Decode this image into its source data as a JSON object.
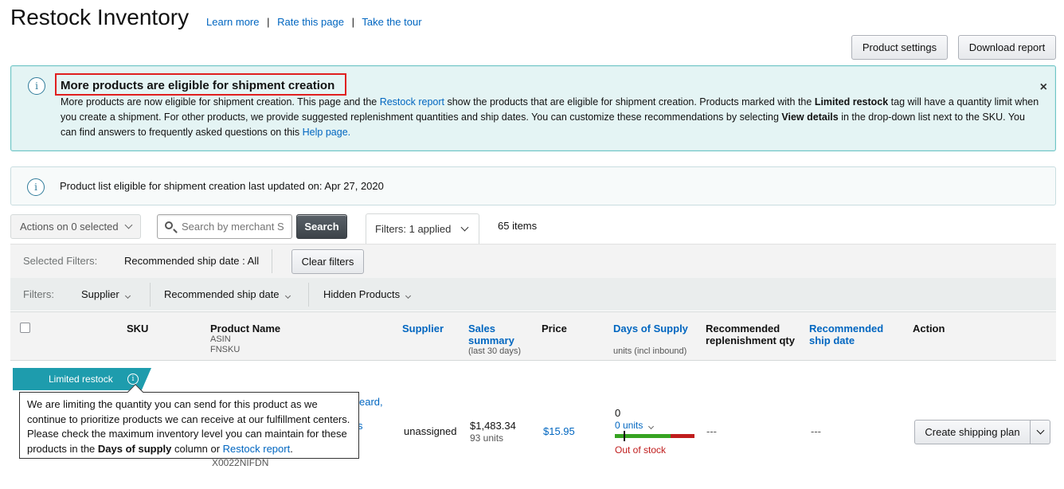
{
  "header": {
    "title": "Restock Inventory",
    "links": [
      "Learn more",
      "Rate this page",
      "Take the tour"
    ],
    "separator": "|"
  },
  "buttons": {
    "product_settings": "Product settings",
    "download_report": "Download report"
  },
  "alert": {
    "title": "More products are eligible for shipment creation",
    "body_1": "More products are now eligible for shipment creation. This page and the ",
    "link_restock_report": "Restock report",
    "body_2": " show the products that are eligible for shipment creation. Products marked with the ",
    "bold_limited_restock": "Limited restock",
    "body_3": " tag will have a quantity limit when you create a shipment. For other products, we provide suggested replenishment quantities and ship dates. You can customize these recommendations by selecting ",
    "bold_view_details": "View details",
    "body_4": " in the drop-down list next to the SKU. You can find answers to frequently asked questions on this ",
    "link_help": "Help page.",
    "close": "×",
    "icon": "info-icon"
  },
  "updated": {
    "text": "Product list eligible for shipment creation last updated on: Apr 27, 2020"
  },
  "toolbar": {
    "actions": "Actions on 0 selected",
    "search_placeholder": "Search by merchant S",
    "search_button": "Search",
    "filters_tab": "Filters: 1 applied",
    "items": "65 items"
  },
  "selected_filters": {
    "label": "Selected Filters:",
    "value": "Recommended ship date : All",
    "clear": "Clear filters"
  },
  "filters": {
    "label": "Filters:",
    "options": [
      "Supplier",
      "Recommended ship date",
      "Hidden Products"
    ]
  },
  "table": {
    "headers": {
      "sku": "SKU",
      "product_name": "Product Name",
      "product_asin": "ASIN",
      "product_fnsku": "FNSKU",
      "supplier": "Supplier",
      "sales_1": "Sales",
      "sales_2": "summary",
      "sales_sub": "(last 30 days)",
      "price": "Price",
      "days_supply": "Days of Supply",
      "days_sub": "units (incl inbound)",
      "rec_qty_1": "Recommended",
      "rec_qty_2": "replenishment qty",
      "rec_ship_1": "Recommended",
      "rec_ship_2": "ship date",
      "action": "Action"
    },
    "row": {
      "tag": "Limited restock",
      "name_fragment_1": "eard,",
      "name_fragment_2": "s",
      "fnsku": "X0022NIFDN",
      "supplier": "unassigned",
      "sales_amount": "$1,483.34",
      "sales_units": "93 units",
      "price": "$15.95",
      "days_value": "0",
      "units_link": "0 units",
      "stock_status": "Out of stock",
      "rec_qty": "---",
      "rec_ship": "---",
      "action": "Create shipping plan"
    }
  },
  "tooltip": {
    "text_1": "We are limiting the quantity you can send for this product as we continue to prioritize products we can receive at our fulfillment centers. Please check the maximum inventory level you can maintain for these products in the ",
    "bold": "Days of supply",
    "text_2": " column or ",
    "link": "Restock report",
    "text_3": "."
  },
  "colors": {
    "accent_link": "#0066c0",
    "alert_bg": "#e4f4f4",
    "tag_teal": "#1e9cad",
    "stock_green": "#37a322",
    "stock_red": "#c01d1d",
    "highlight_red": "#e01f1f"
  }
}
